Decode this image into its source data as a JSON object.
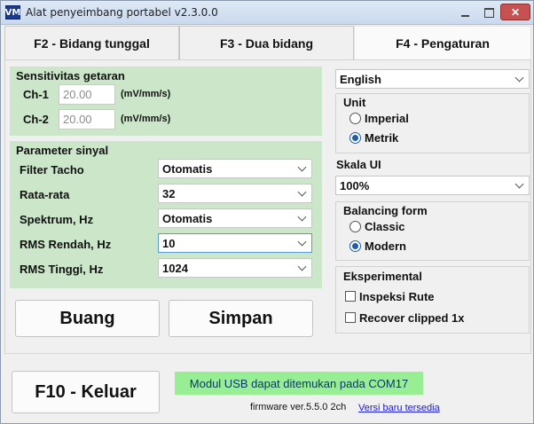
{
  "window": {
    "icon_text": "VM",
    "title": "Alat penyeimbang portabel v2.3.0.0",
    "controls": {
      "minimize": "",
      "maximize": "",
      "close": "✕"
    }
  },
  "tabs": [
    {
      "label": "F2 - Bidang tunggal",
      "selected": false
    },
    {
      "label": "F3 - Dua bidang",
      "selected": false
    },
    {
      "label": "F4 - Pengaturan",
      "selected": true
    }
  ],
  "sensitivity": {
    "title": "Sensitivitas getaran",
    "channels": [
      {
        "label": "Ch-1",
        "value": "20.00",
        "unit": "(mV/mm/s)"
      },
      {
        "label": "Ch-2",
        "value": "20.00",
        "unit": "(mV/mm/s)"
      }
    ]
  },
  "signal": {
    "title": "Parameter sinyal",
    "rows": [
      {
        "label": "Filter Tacho",
        "value": "Otomatis"
      },
      {
        "label": "Rata-rata",
        "value": "32"
      },
      {
        "label": "Spektrum, Hz",
        "value": "Otomatis"
      },
      {
        "label": "RMS Rendah, Hz",
        "value": "10"
      },
      {
        "label": "RMS Tinggi, Hz",
        "value": "1024"
      }
    ]
  },
  "buttons": {
    "discard": "Buang",
    "save": "Simpan",
    "exit": "F10 - Keluar"
  },
  "language": {
    "value": "English"
  },
  "unit": {
    "title": "Unit",
    "options": [
      {
        "label": "Imperial",
        "checked": false
      },
      {
        "label": "Metrik",
        "checked": true
      }
    ]
  },
  "ui_scale": {
    "title": "Skala UI",
    "value": "100%"
  },
  "balancing_form": {
    "title": "Balancing form",
    "options": [
      {
        "label": "Classic",
        "checked": false
      },
      {
        "label": "Modern",
        "checked": true
      }
    ]
  },
  "experimental": {
    "title": "Eksperimental",
    "options": [
      {
        "label": "Inspeksi Rute",
        "checked": false
      },
      {
        "label": "Recover clipped 1x",
        "checked": false
      }
    ]
  },
  "status": {
    "message": "Modul USB dapat ditemukan pada COM17",
    "firmware": "firmware ver.5.5.0 2ch",
    "update_link": "Versi baru tersedia"
  },
  "colors": {
    "panel_green": "#cbe6c9",
    "status_green": "#98ee92",
    "radio_accent": "#1f5faa",
    "link_blue": "#1a1ad8"
  }
}
